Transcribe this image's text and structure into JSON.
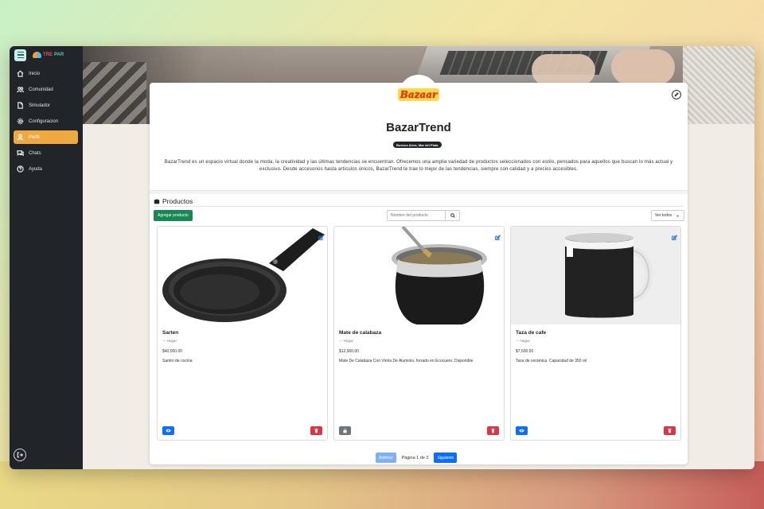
{
  "app": {
    "logo_text_a": "TRE",
    "logo_text_b": "PAR"
  },
  "sidebar": {
    "items": [
      {
        "label": "Inicio",
        "icon": "home-icon",
        "active": false
      },
      {
        "label": "Comunidad",
        "icon": "users-icon",
        "active": false
      },
      {
        "label": "Simulador",
        "icon": "file-icon",
        "active": false
      },
      {
        "label": "Configuracion",
        "icon": "gear-icon",
        "active": false
      },
      {
        "label": "Perfil",
        "icon": "user-icon",
        "active": true
      },
      {
        "label": "Chats",
        "icon": "chat-icon",
        "active": false
      },
      {
        "label": "Ayuda",
        "icon": "help-icon",
        "active": false
      }
    ],
    "active_color": "#f0a940"
  },
  "store": {
    "logo_text": "Bazaar",
    "name": "BazarTrend",
    "location": "Buenos Aires, Mar del Plata",
    "description": "BazarTrend es un espacio virtual donde la moda, la creatividad y las últimas tendencias se encuentran. Ofrecemos una amplia variedad de productos seleccionados con estilo, pensados para aquellos que buscan lo más actual y exclusivo. Desde accesorios hasta artículos únicos, BazarTrend te trae lo mejor de las tendencias, siempre con calidad y a precios accesibles."
  },
  "products_section": {
    "title": "Productos",
    "add_button": "Agregar producto",
    "search_placeholder": "Nombre del producto",
    "filter_selected": "Ver todos"
  },
  "products": [
    {
      "name": "Sarten",
      "category": "Hogar",
      "price": "$40,000.00",
      "description": "Sartén de cocina",
      "locked": false
    },
    {
      "name": "Mate de calabaza",
      "category": "Hogar",
      "price": "$12,900.00",
      "description": "Mate De Calabaza Con Virola De Aluminio, forrado en Ecocuero. Disponible",
      "locked": true
    },
    {
      "name": "Taza de cafe",
      "category": "Hogar",
      "price": "$7,500.00",
      "description": "Taza de cerámica. Capacidad de 350 ml",
      "locked": false
    }
  ],
  "pagination": {
    "prev": "Anterior",
    "page_text": "Página 1 de 2",
    "next": "Siguiente"
  }
}
